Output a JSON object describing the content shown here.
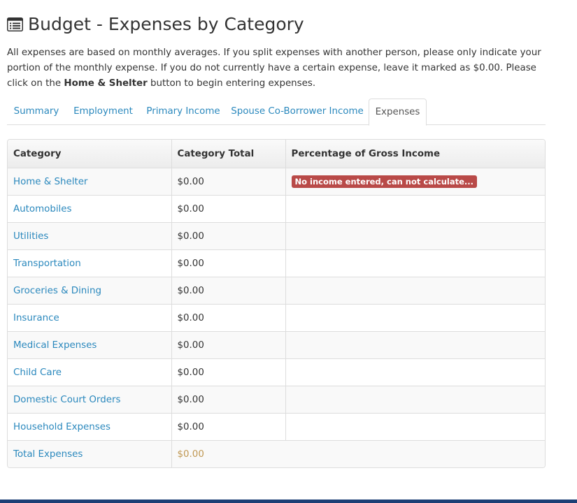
{
  "page": {
    "title": "Budget - Expenses by Category",
    "title_icon": "list-icon",
    "intro_part1": "All expenses are based on monthly averages. If you split expenses with another person, please only indicate your portion of the monthly expense. If you do not currently have a certain expense, leave it marked as $0.00. Please click on the ",
    "intro_bold": "Home & Shelter",
    "intro_part2": " button to begin entering expenses."
  },
  "tabs": [
    {
      "label": "Summary",
      "active": false
    },
    {
      "label": "Employment",
      "active": false
    },
    {
      "label": "Primary Income",
      "active": false
    },
    {
      "label": "Spouse Co-Borrower Income",
      "active": false
    },
    {
      "label": "Expenses",
      "active": true
    }
  ],
  "table": {
    "headers": [
      "Category",
      "Category Total",
      "Percentage of Gross Income"
    ],
    "rows": [
      {
        "category": "Home & Shelter",
        "total": "$0.00",
        "percentage": "No income entered, can not calculate..."
      },
      {
        "category": "Automobiles",
        "total": "$0.00",
        "percentage": ""
      },
      {
        "category": "Utilities",
        "total": "$0.00",
        "percentage": ""
      },
      {
        "category": "Transportation",
        "total": "$0.00",
        "percentage": ""
      },
      {
        "category": "Groceries & Dining",
        "total": "$0.00",
        "percentage": ""
      },
      {
        "category": "Insurance",
        "total": "$0.00",
        "percentage": ""
      },
      {
        "category": "Medical Expenses",
        "total": "$0.00",
        "percentage": ""
      },
      {
        "category": "Child Care",
        "total": "$0.00",
        "percentage": ""
      },
      {
        "category": "Domestic Court Orders",
        "total": "$0.00",
        "percentage": ""
      },
      {
        "category": "Household Expenses",
        "total": "$0.00",
        "percentage": ""
      }
    ],
    "total_row": {
      "label": "Total Expenses",
      "total": "$0.00"
    }
  },
  "colors": {
    "link": "#2a88bd",
    "warning_badge": "#b94a48",
    "total_amount": "#c09853",
    "bottom_bar": "#1c3f75"
  }
}
